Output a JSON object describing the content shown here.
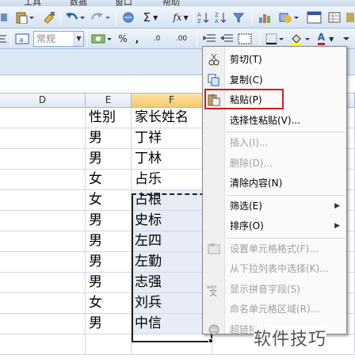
{
  "menubar": {
    "items": [
      "工具",
      "数据",
      "窗口",
      "帮助"
    ]
  },
  "toolbar": {
    "font_size_combo": "常规",
    "autosum_label": "Σ",
    "function_label": "fx",
    "percent_label": "%",
    "comma_label": ",",
    "decimal_increase_label": ".0",
    "decimal_decrease_label": ".00",
    "font_color_label": "A"
  },
  "columns": [
    {
      "label": "D",
      "selected": false
    },
    {
      "label": "E",
      "selected": false
    },
    {
      "label": "F",
      "selected": true
    }
  ],
  "rows": [
    {
      "gender": "性别",
      "parent": "家长姓名",
      "selected": false
    },
    {
      "gender": "男",
      "parent": "丁祥",
      "selected": false
    },
    {
      "gender": "男",
      "parent": "丁林",
      "selected": false
    },
    {
      "gender": "女",
      "parent": "占乐",
      "selected": false
    },
    {
      "gender": "女",
      "parent": "占根",
      "selected": true
    },
    {
      "gender": "男",
      "parent": "史标",
      "selected": true
    },
    {
      "gender": "男",
      "parent": "左四",
      "selected": true
    },
    {
      "gender": "男",
      "parent": "左勤",
      "selected": true
    },
    {
      "gender": "男",
      "parent": "志强",
      "selected": true
    },
    {
      "gender": "女",
      "parent": "刘兵",
      "selected": true
    },
    {
      "gender": "男",
      "parent": "中信",
      "selected": true
    }
  ],
  "context_menu": {
    "items": [
      {
        "label": "剪切(T)",
        "icon": "scissors-icon",
        "disabled": false
      },
      {
        "label": "复制(C)",
        "icon": "copy-icon",
        "disabled": false
      },
      {
        "label": "粘贴(P)",
        "icon": "paste-icon",
        "disabled": false,
        "highlighted": true
      },
      {
        "label": "选择性粘贴(V)...",
        "disabled": false
      },
      {
        "label": "插入(I)...",
        "disabled": true
      },
      {
        "label": "删除(D)...",
        "disabled": true
      },
      {
        "label": "清除内容(N)",
        "disabled": false
      },
      {
        "label": "筛选(E)",
        "disabled": false,
        "submenu": true
      },
      {
        "label": "排序(O)",
        "disabled": false,
        "submenu": true
      },
      {
        "label": "设置单元格格式(F)...",
        "icon": "format-cells-icon",
        "disabled": true
      },
      {
        "label": "从下拉列表中选择(K)...",
        "disabled": true
      },
      {
        "label": "显示拼音字段(S)",
        "icon": "phonetic-icon",
        "disabled": true
      },
      {
        "label": "命名单元格区域(R)...",
        "disabled": true
      },
      {
        "label": "超链接(H)...",
        "icon": "hyperlink-icon",
        "disabled": true
      }
    ],
    "highlight_color": "#cc2020"
  },
  "watermark": "软件技巧"
}
